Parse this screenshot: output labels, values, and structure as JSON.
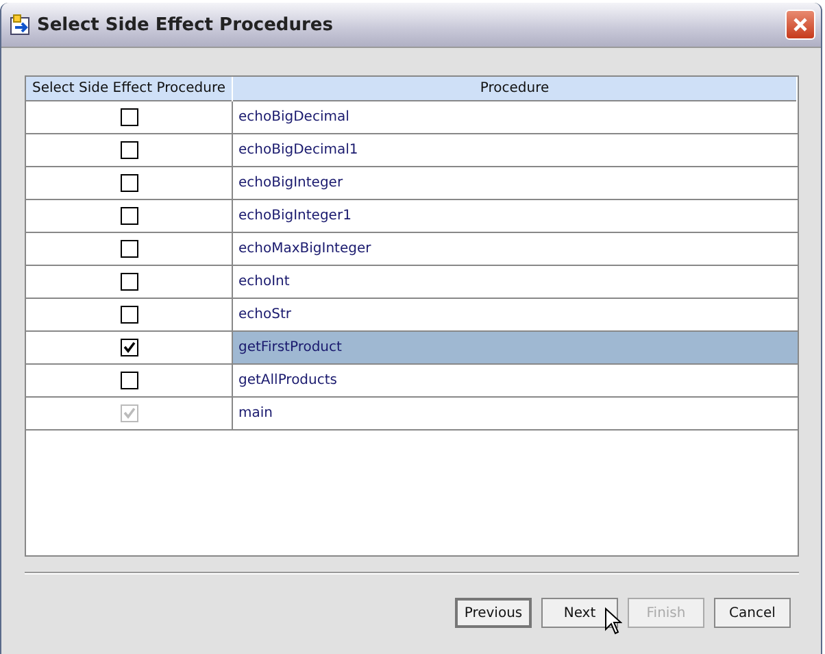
{
  "window": {
    "title": "Select Side Effect Procedures"
  },
  "table": {
    "columns": [
      "Select Side Effect Procedure",
      "Procedure"
    ],
    "rows": [
      {
        "procedure": "echoBigDecimal",
        "checked": false,
        "selected": false,
        "disabled": false
      },
      {
        "procedure": "echoBigDecimal1",
        "checked": false,
        "selected": false,
        "disabled": false
      },
      {
        "procedure": "echoBigInteger",
        "checked": false,
        "selected": false,
        "disabled": false
      },
      {
        "procedure": "echoBigInteger1",
        "checked": false,
        "selected": false,
        "disabled": false
      },
      {
        "procedure": "echoMaxBigInteger",
        "checked": false,
        "selected": false,
        "disabled": false
      },
      {
        "procedure": "echoInt",
        "checked": false,
        "selected": false,
        "disabled": false
      },
      {
        "procedure": "echoStr",
        "checked": false,
        "selected": false,
        "disabled": false
      },
      {
        "procedure": "getFirstProduct",
        "checked": true,
        "selected": true,
        "disabled": false
      },
      {
        "procedure": "getAllProducts",
        "checked": false,
        "selected": false,
        "disabled": false
      },
      {
        "procedure": "main",
        "checked": true,
        "selected": false,
        "disabled": true
      }
    ]
  },
  "buttons": [
    {
      "label": "Previous",
      "default": true,
      "disabled": false
    },
    {
      "label": "Next",
      "default": false,
      "disabled": false
    },
    {
      "label": "Finish",
      "default": false,
      "disabled": true
    },
    {
      "label": "Cancel",
      "default": false,
      "disabled": false
    }
  ]
}
